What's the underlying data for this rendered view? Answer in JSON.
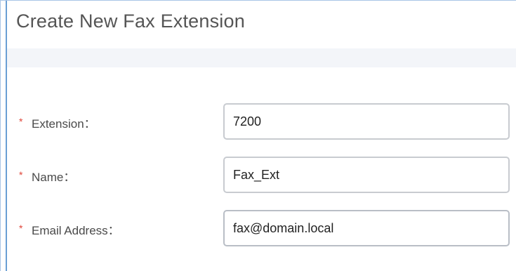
{
  "dialog": {
    "title": "Create New Fax Extension"
  },
  "form": {
    "required_marker": "*",
    "fields": [
      {
        "label": "Extension：",
        "value": "7200"
      },
      {
        "label": "Name：",
        "value": "Fax_Ext"
      },
      {
        "label": "Email Address：",
        "value": "fax@domain.local"
      }
    ]
  }
}
